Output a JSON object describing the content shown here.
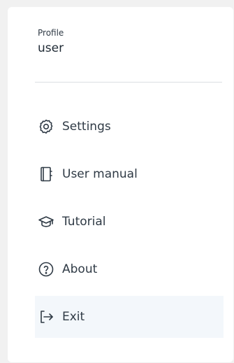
{
  "profile": {
    "label": "Profile",
    "username": "user"
  },
  "menu": {
    "items": [
      {
        "label": "Settings",
        "icon": "gear-icon"
      },
      {
        "label": "User manual",
        "icon": "book-icon"
      },
      {
        "label": "Tutorial",
        "icon": "graduation-cap-icon"
      },
      {
        "label": "About",
        "icon": "question-circle-icon"
      },
      {
        "label": "Exit",
        "icon": "exit-icon",
        "highlighted": true
      }
    ]
  },
  "colors": {
    "panel_background": "#ffffff",
    "page_background": "#f1f1f1",
    "text": "#2f3a45",
    "divider": "#dcdfe3",
    "active_item_background": "#f3f7fb"
  }
}
